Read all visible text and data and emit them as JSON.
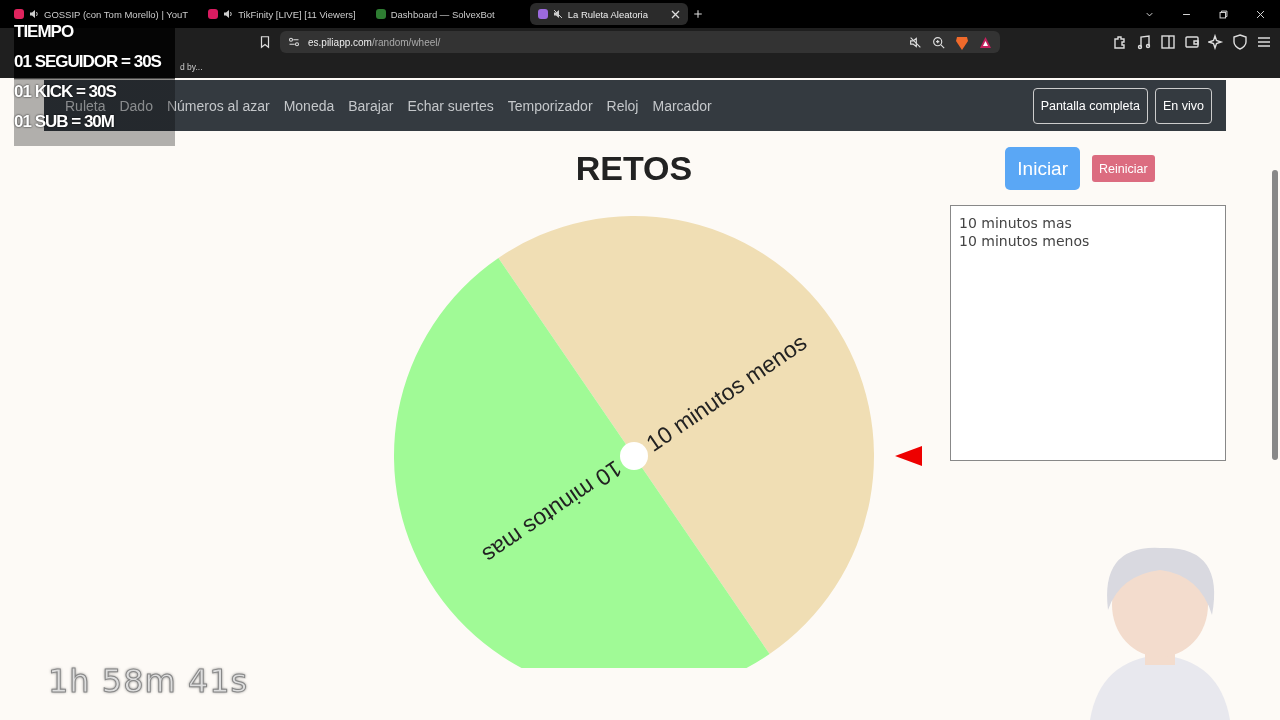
{
  "browser": {
    "tabs": [
      {
        "title": "GOSSIP (con Tom Morello) | YouT",
        "selected": false,
        "audio": true
      },
      {
        "title": "TikFinity [LIVE] [11 Viewers]",
        "selected": false,
        "audio": true
      },
      {
        "title": "Dashboard — SolvexBot",
        "selected": false,
        "audio": false
      },
      {
        "title": "La Ruleta Aleatoria",
        "selected": true,
        "audio": true
      }
    ],
    "url_domain": "es.piliapp.com",
    "url_path": "/random/wheel/",
    "bookmark": "d by..."
  },
  "navbar": {
    "items": [
      "Ruleta",
      "Dado",
      "Números al azar",
      "Moneda",
      "Barajar",
      "Echar suertes",
      "Temporizador",
      "Reloj",
      "Marcador"
    ],
    "buttons": [
      "Pantalla completa",
      "En vivo"
    ]
  },
  "title": "RETOS",
  "wheel": {
    "segments": [
      {
        "label": "10 minutos menos",
        "color": "#f0deb4"
      },
      {
        "label": "10 minutos mas",
        "color": "#a0fa96"
      }
    ]
  },
  "controls": {
    "start": "Iniciar",
    "reset": "Reiniciar"
  },
  "entries": "10 minutos mas\n10 minutos menos",
  "overlay": {
    "lines": [
      "TIEMPO",
      "01 SEGUIDOR = 30S",
      "01 KICK = 30S",
      "01 SUB = 30M"
    ],
    "timer": "1h 58m 41s"
  }
}
